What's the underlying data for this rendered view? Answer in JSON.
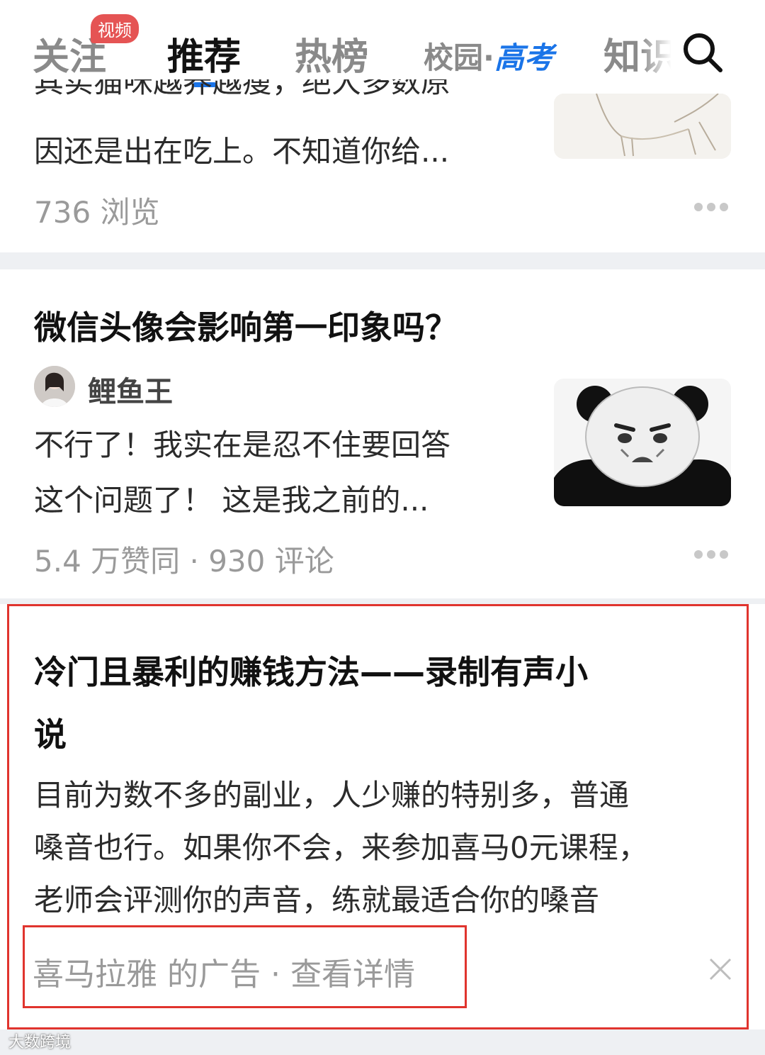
{
  "nav": {
    "tabs": [
      {
        "label": "关注",
        "active": false
      },
      {
        "label": "推荐",
        "active": true
      },
      {
        "label": "热榜",
        "active": false
      },
      {
        "label_prefix": "校园·",
        "label_highlight": "高考",
        "active": false
      },
      {
        "label": "知识",
        "active": false
      }
    ],
    "video_badge": "视频",
    "search_icon": "search-icon",
    "accent_color": "#1a74e8"
  },
  "feed": [
    {
      "excerpt_lines": [
        "其实猫咪越养越瘦，绝大多数原",
        "因还是出在吃上。不知道你给..."
      ],
      "stats": "736 浏览",
      "thumb_icon": "cat-illustration"
    },
    {
      "title": "微信头像会影响第一印象吗？",
      "author": "鲤鱼王",
      "excerpt_lines": [
        "不行了！我实在是忍不住要回答",
        "这个问题了！ 这是我之前的..."
      ],
      "stats": "5.4 万赞同 · 930 评论",
      "thumb_icon": "panda-meme"
    },
    {
      "title_lines": [
        "冷门且暴利的赚钱方法——录制有声小",
        "说"
      ],
      "excerpt_lines": [
        "目前为数不多的副业，人少赚的特别多，普通",
        "嗓音也行。如果你不会，来参加喜马0元课程，",
        "老师会评测你的声音，练就最适合你的嗓音"
      ],
      "ad_footer": "喜马拉雅 的广告 · 查看详情",
      "close_icon": "close-icon"
    }
  ],
  "highlight_color": "#e0342e",
  "watermark": "大数跨境"
}
